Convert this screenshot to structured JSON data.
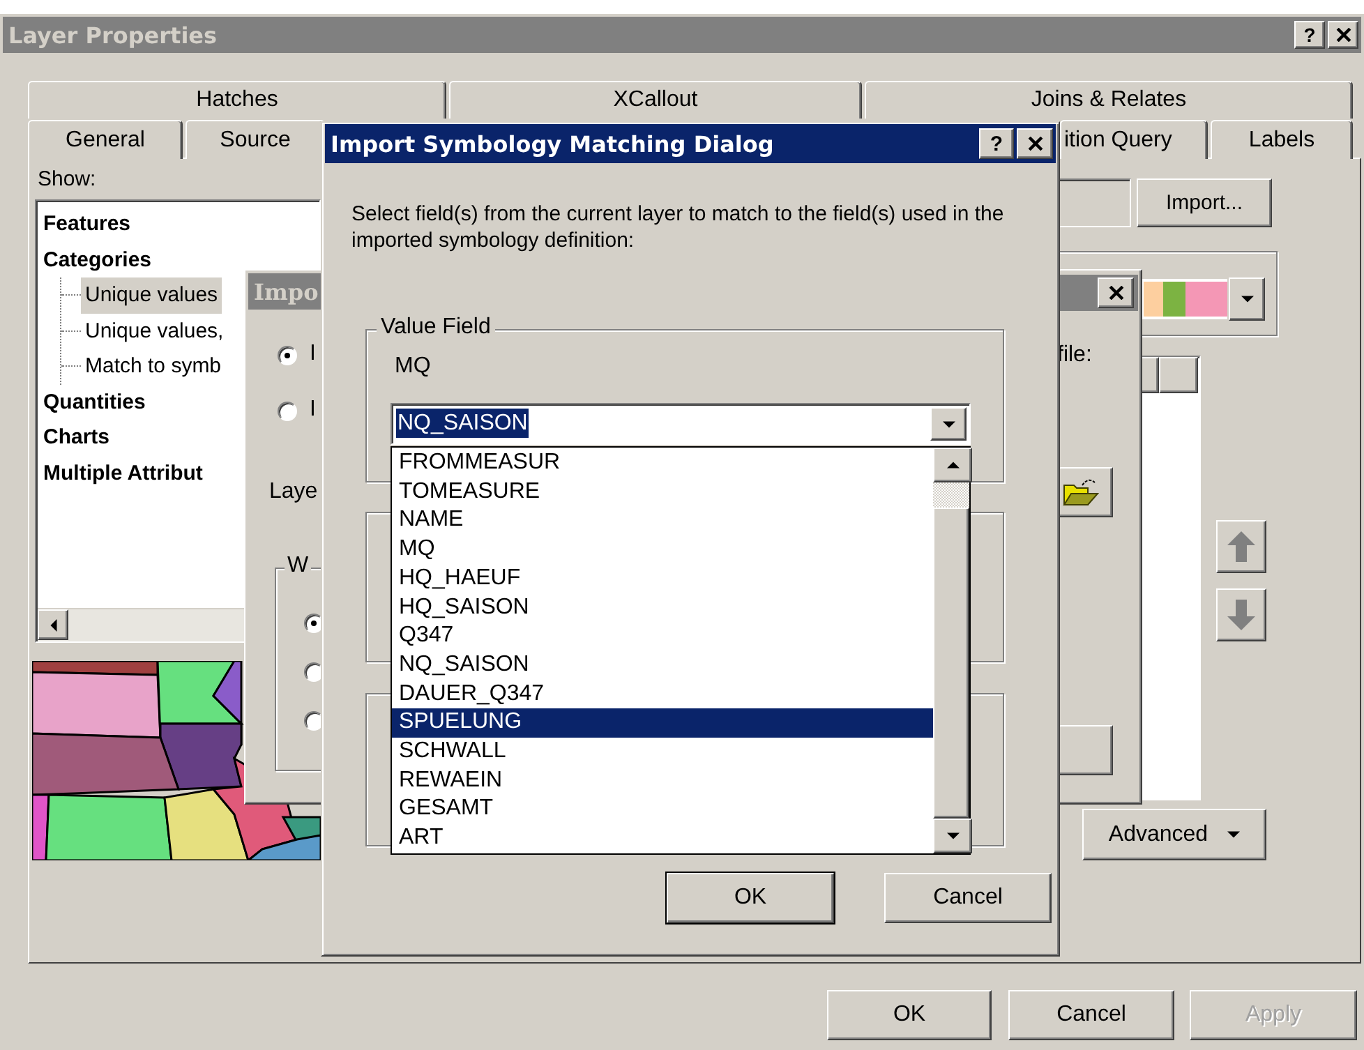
{
  "window": {
    "title": "Layer Properties",
    "help": "?",
    "active": false
  },
  "tabs_top": [
    {
      "label": "Hatches",
      "selected": false
    },
    {
      "label": "XCallout",
      "selected": false
    },
    {
      "label": "Joins & Relates",
      "selected": false
    }
  ],
  "tabs_bottom": [
    {
      "label": "General",
      "selected": false
    },
    {
      "label": "Source",
      "selected": false
    },
    {
      "label": "ition Query",
      "selected": false
    },
    {
      "label": "Labels",
      "selected": false
    }
  ],
  "show_label": "Show:",
  "show_tree": [
    {
      "label": "Features",
      "selected": false
    },
    {
      "label": "Categories",
      "selected": false,
      "children": [
        {
          "label": "Unique values",
          "selected": true
        },
        {
          "label": "Unique values,",
          "selected": false
        },
        {
          "label": "Match to symb",
          "selected": false
        }
      ]
    },
    {
      "label": "Quantities",
      "selected": false
    },
    {
      "label": "Charts",
      "selected": false
    },
    {
      "label": "Multiple Attribut",
      "selected": false
    }
  ],
  "import_button": "Import...",
  "file_label": "file:",
  "advanced_button": "Advanced",
  "back_dialog": {
    "title": "Impo",
    "radios": [
      {
        "label": "I",
        "selected": true
      },
      {
        "label": "I",
        "selected": false
      }
    ],
    "layer_label": "Laye",
    "group_title": "W",
    "group_radios": [
      {
        "selected": true
      },
      {
        "selected": false
      },
      {
        "selected": false
      }
    ]
  },
  "dialog": {
    "title": "Import Symbology Matching Dialog",
    "help": "?",
    "instructions": "Select field(s) from the current layer to match to the field(s) used in the imported symbology definition:",
    "group_title": "Value Field",
    "field_name": "MQ",
    "combo_value": "NQ_SAISON",
    "options": [
      {
        "label": "FROMMEASUR",
        "selected": false
      },
      {
        "label": "TOMEASURE",
        "selected": false
      },
      {
        "label": "NAME",
        "selected": false
      },
      {
        "label": "MQ",
        "selected": false
      },
      {
        "label": "HQ_HAEUF",
        "selected": false
      },
      {
        "label": "HQ_SAISON",
        "selected": false
      },
      {
        "label": "Q347",
        "selected": false
      },
      {
        "label": "NQ_SAISON",
        "selected": false
      },
      {
        "label": "DAUER_Q347",
        "selected": false
      },
      {
        "label": "SPUELUNG",
        "selected": true
      },
      {
        "label": "SCHWALL",
        "selected": false
      },
      {
        "label": "REWAEIN",
        "selected": false
      },
      {
        "label": "GESAMT",
        "selected": false
      },
      {
        "label": "ART",
        "selected": false
      }
    ],
    "buttons": [
      {
        "label": "OK",
        "default": true
      },
      {
        "label": "Cancel",
        "default": false
      }
    ]
  },
  "buttons": [
    {
      "label": "OK",
      "disabled": false
    },
    {
      "label": "Cancel",
      "disabled": false
    },
    {
      "label": "Apply",
      "disabled": true
    }
  ]
}
